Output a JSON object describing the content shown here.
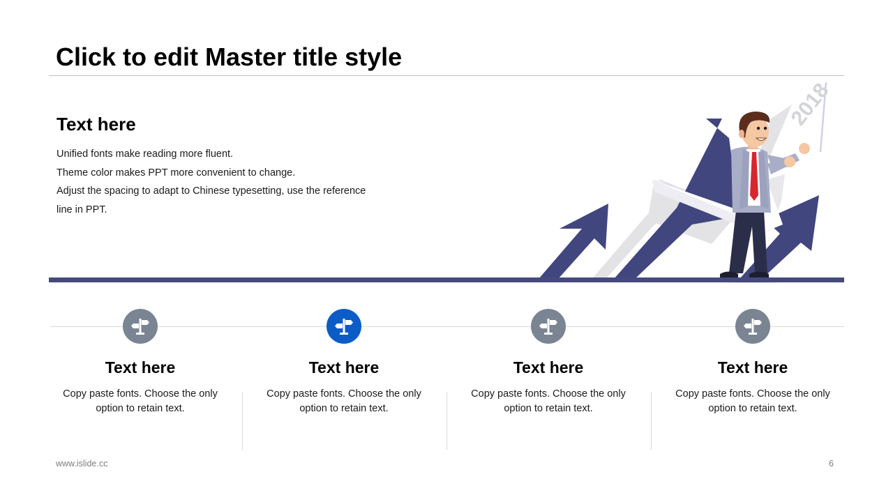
{
  "slide": {
    "title": "Click to edit Master title style",
    "intro": {
      "heading": "Text here",
      "lines": [
        "Unified fonts make reading more fluent.",
        "Theme color makes PPT more convenient to change.",
        "Adjust the spacing to adapt to Chinese typesetting, use the reference",
        "line in PPT."
      ]
    },
    "illustration": {
      "year_text": "2018",
      "icon": "businessman-growth-arrows-illustration"
    },
    "items": [
      {
        "title": "Text here",
        "desc": "Copy paste fonts. Choose the only option to retain text.",
        "icon": "signpost-icon",
        "color": "#7a8493",
        "active": false
      },
      {
        "title": "Text here",
        "desc": "Copy paste fonts. Choose the only option to retain text.",
        "icon": "signpost-icon",
        "color": "#0b5cc7",
        "active": true
      },
      {
        "title": "Text here",
        "desc": "Copy paste fonts. Choose the only option to retain text.",
        "icon": "signpost-icon",
        "color": "#7a8493",
        "active": false
      },
      {
        "title": "Text here",
        "desc": "Copy paste fonts. Choose the only option to retain text.",
        "icon": "signpost-icon",
        "color": "#7a8493",
        "active": false
      }
    ],
    "footer": {
      "url": "www.islide.cc",
      "page": "6"
    },
    "colors": {
      "band": "#454a7c",
      "arrow": "#42467e",
      "accent": "#0b5cc7",
      "icon_gray": "#7a8493"
    }
  }
}
